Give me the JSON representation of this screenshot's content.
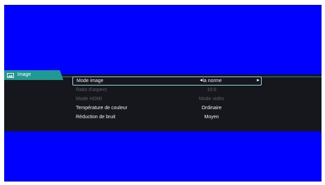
{
  "colors": {
    "background": "#0000ff",
    "osd_bar": "#15171d",
    "tab": "#1f9a92",
    "selection_border": "#9fd0e8",
    "disabled_text": "#5f6268"
  },
  "tab": {
    "icon": "picture-icon",
    "label": "Image"
  },
  "menu": {
    "items": [
      {
        "label": "Mode image",
        "value": "la norme",
        "selected": true,
        "enabled": true,
        "left_arrow": "◄",
        "right_arrow": "►"
      },
      {
        "label": "Ratio d'aspect",
        "value": "16:9",
        "selected": false,
        "enabled": false
      },
      {
        "label": "Mode HDMI",
        "value": "Mode vidéo",
        "selected": false,
        "enabled": false
      },
      {
        "label": "Température de couleur",
        "value": "Ordinaire",
        "selected": false,
        "enabled": true
      },
      {
        "label": "Réduction de bruit",
        "value": "Moyen",
        "selected": false,
        "enabled": true
      }
    ]
  }
}
